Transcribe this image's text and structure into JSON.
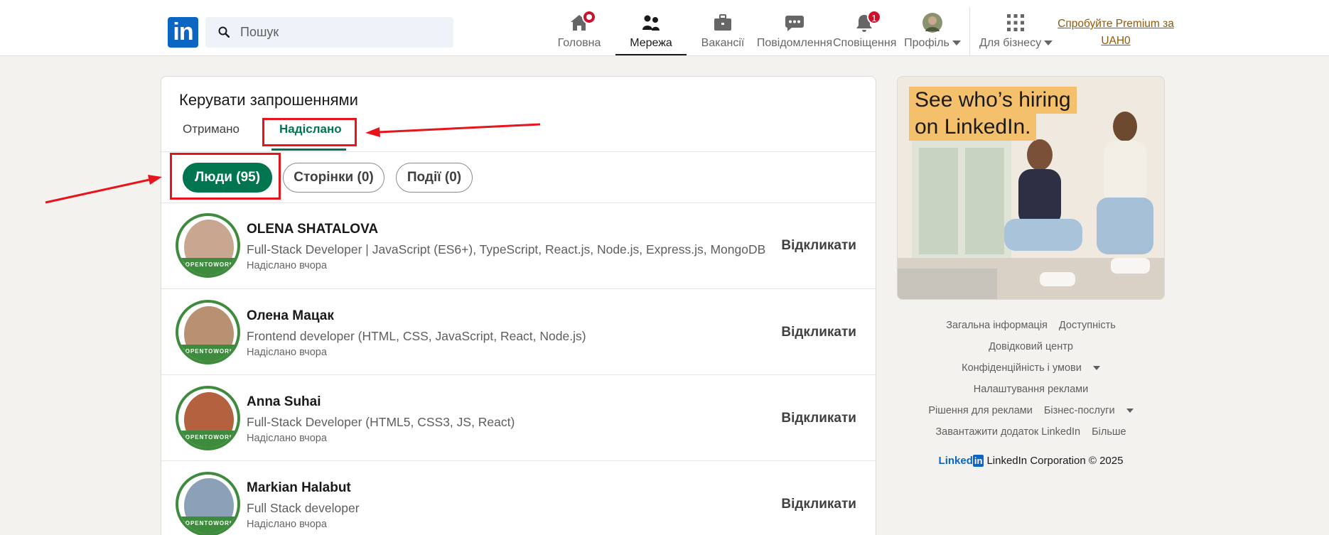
{
  "header": {
    "logo_text": "in",
    "search_placeholder": "Пошук",
    "nav": [
      {
        "label": "Головна",
        "icon": "home-icon"
      },
      {
        "label": "Мережа",
        "icon": "network-icon"
      },
      {
        "label": "Вакансії",
        "icon": "briefcase-icon"
      },
      {
        "label": "Повідомлення",
        "icon": "messaging-icon"
      },
      {
        "label": "Сповіщення",
        "icon": "bell-icon",
        "badge": "1"
      },
      {
        "label": "Профіль",
        "icon": "avatar"
      },
      {
        "label": "Для бізнесу",
        "icon": "grid-icon"
      }
    ],
    "premium_line1": "Спробуйте Premium за",
    "premium_line2": "UAH0"
  },
  "invitations": {
    "title": "Керувати запрошеннями",
    "tab_received": "Отримано",
    "tab_sent": "Надіслано",
    "filters": [
      "Люди (95)",
      "Сторінки (0)",
      "Події (0)"
    ],
    "withdraw_label": "Відкликати",
    "ring_text": "#OPENTOWORK",
    "people": [
      {
        "name": "OLENA SHATALOVA",
        "headline": "Full-Stack Developer | JavaScript (ES6+), TypeScript, React.js, Node.js, Express.js, MongoDB",
        "sent": "Надіслано вчора"
      },
      {
        "name": "Олена Мацак",
        "headline": "Frontend developer (HTML, CSS, JavaScript, React, Node.js)",
        "sent": "Надіслано вчора"
      },
      {
        "name": "Anna Suhai",
        "headline": "Full-Stack Developer (HTML5, CSS3, JS, React)",
        "sent": "Надіслано вчора"
      },
      {
        "name": "Markian Halabut",
        "headline": "Full Stack developer",
        "sent": "Надіслано вчора"
      }
    ]
  },
  "ad": {
    "line1": "See who’s hiring",
    "line2": "on LinkedIn."
  },
  "footer": {
    "about": "Загальна інформація",
    "accessibility": "Доступність",
    "help": "Довідковий центр",
    "privacy": "Конфіденційність і умови",
    "ad_settings": "Налаштування реклами",
    "ad_solutions": "Рішення для реклами",
    "business": "Бізнес-послуги",
    "get_app": "Завантажити додаток LinkedIn",
    "more": "Більше",
    "brand_word": "Linked",
    "brand_in": "in",
    "copyright": "LinkedIn Corporation © 2025"
  },
  "colors": {
    "accent_green": "#01754f",
    "linkedin_blue": "#0a66c2",
    "annotation_red": "#e8141b",
    "badge_red": "#cb112d"
  }
}
